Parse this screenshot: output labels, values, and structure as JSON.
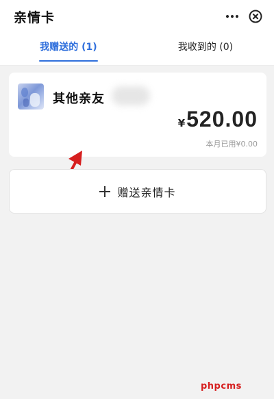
{
  "header": {
    "title": "亲情卡",
    "more_icon": "more-dots-icon",
    "close_icon": "close-circle-icon"
  },
  "tabs": [
    {
      "label": "我赠送的 (1)",
      "active": true
    },
    {
      "label": "我收到的 (0)",
      "active": false
    }
  ],
  "colors": {
    "accent": "#2f6fdc",
    "annotation_arrow": "#d61f1f",
    "watermark": "#d61f1f"
  },
  "card": {
    "name": "其他亲友",
    "currency_symbol": "¥",
    "amount": "520.00",
    "used_text": "本月已用¥0.00"
  },
  "gift_button": {
    "icon": "plus-icon",
    "label": "赠送亲情卡"
  },
  "watermark": "phpcms"
}
